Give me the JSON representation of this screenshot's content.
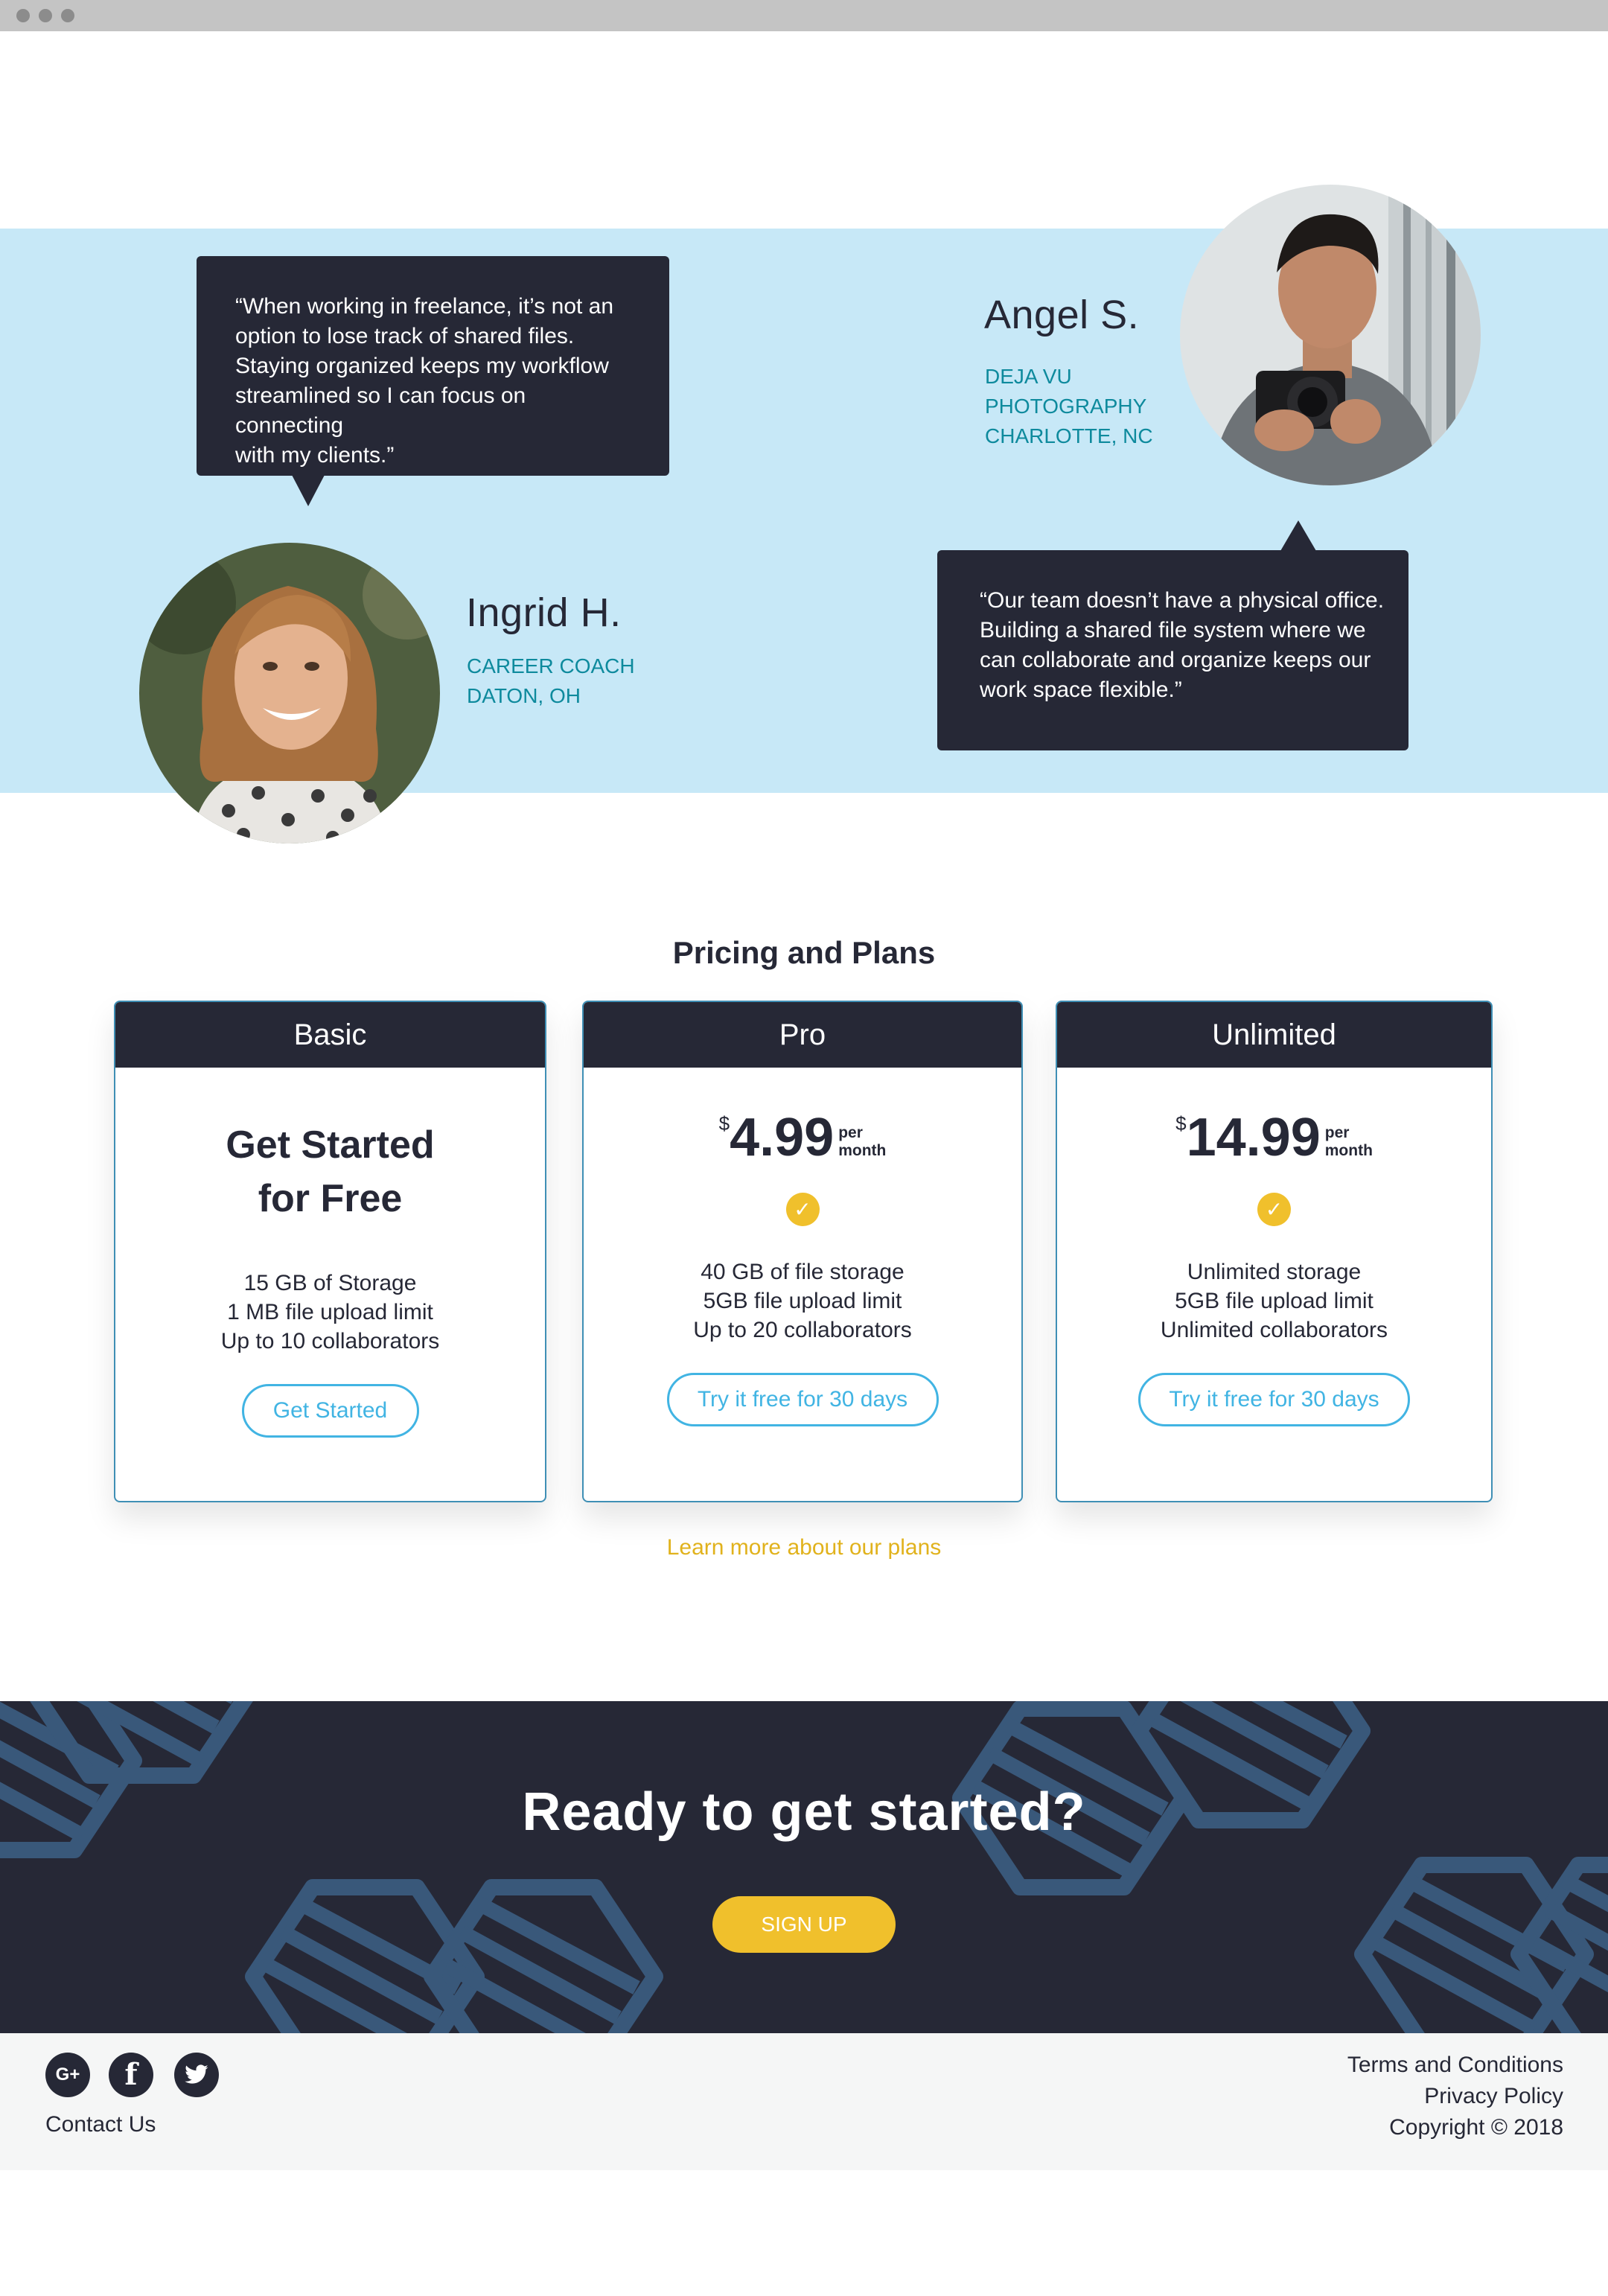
{
  "testimonials": [
    {
      "quote_lines": [
        "“When working in freelance, it’s not an",
        "option to lose track of shared files.",
        "Staying organized keeps my workflow",
        "streamlined so I can focus on connecting",
        "with my clients.”"
      ],
      "name": "Ingrid H.",
      "role": "CAREER COACH",
      "location": "DATON, OH"
    },
    {
      "quote_lines": [
        "“Our team doesn’t have a physical office.",
        "Building a shared file system where we",
        "can collaborate and organize keeps our",
        "work space flexible.”"
      ],
      "name": "Angel S.",
      "role_lines": [
        "DEJA VU",
        "PHOTOGRAPHY"
      ],
      "location": "CHARLOTTE, NC"
    }
  ],
  "pricing": {
    "title": "Pricing and Plans",
    "plans": [
      {
        "name": "Basic",
        "headline_lines": [
          "Get Started",
          "for Free"
        ],
        "features": [
          "15 GB of Storage",
          "1 MB file upload limit",
          "Up to 10 collaborators"
        ],
        "button": "Get Started"
      },
      {
        "name": "Pro",
        "currency": "$",
        "price": "4.99",
        "per_lines": [
          "per",
          "month"
        ],
        "features": [
          "40 GB of file storage",
          "5GB file upload limit",
          "Up to 20 collaborators"
        ],
        "button": "Try it free for 30 days"
      },
      {
        "name": "Unlimited",
        "currency": "$",
        "price": "14.99",
        "per_lines": [
          "per",
          "month"
        ],
        "features": [
          "Unlimited storage",
          "5GB file upload limit",
          "Unlimited collaborators"
        ],
        "button": "Try it free for 30 days"
      }
    ],
    "learn_more": "Learn more about our plans",
    "check_icon": "✓"
  },
  "cta": {
    "title": "Ready to get started?",
    "button": "SIGN UP"
  },
  "footer": {
    "social": [
      {
        "icon": "google-plus-icon",
        "glyph": "G+"
      },
      {
        "icon": "facebook-icon",
        "glyph": "f"
      },
      {
        "icon": "twitter-icon"
      }
    ],
    "contact": "Contact Us",
    "links": [
      "Terms and Conditions",
      "Privacy Policy"
    ],
    "copyright": "Copyright © 2018"
  },
  "colors": {
    "navy": "#262836",
    "light_blue_band": "#c7e8f7",
    "teal_text": "#0e8a9d",
    "accent_blue": "#41b4e3",
    "accent_yellow": "#f0c02c",
    "pattern_blue": "#39587a",
    "footer_bg": "#f5f6f6"
  }
}
